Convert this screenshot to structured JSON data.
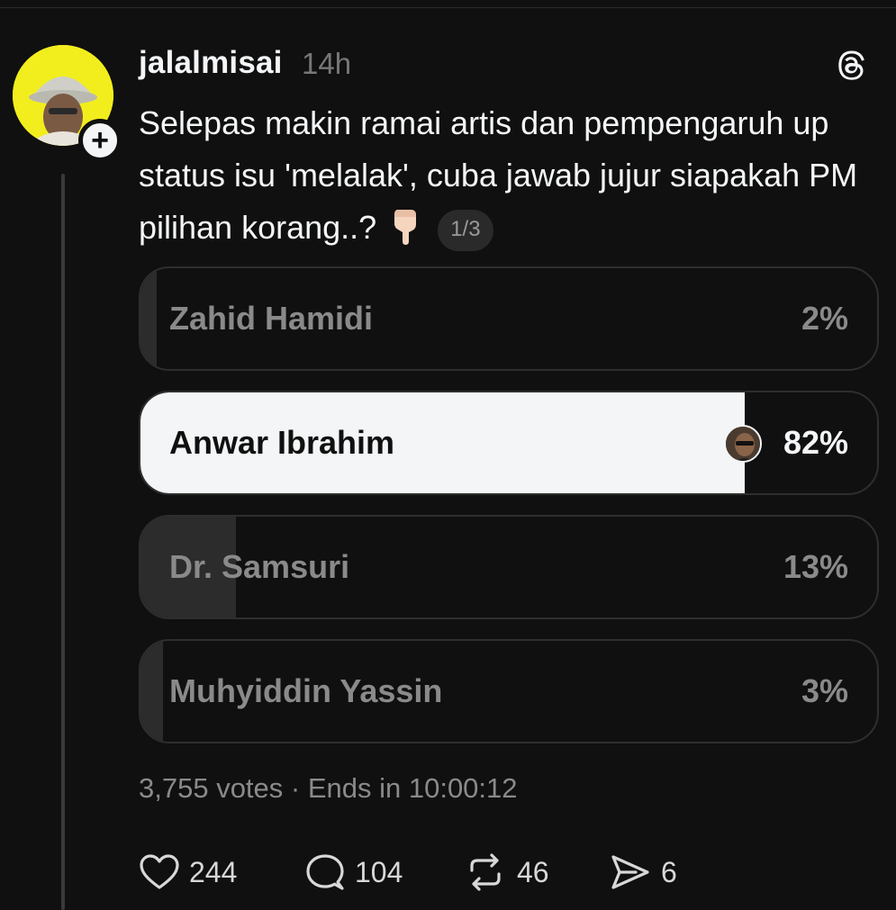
{
  "post": {
    "username": "jalalmisai",
    "timestamp": "14h",
    "text": "Selepas makin ramai artis dan pempengaruh up status isu 'melalak', cuba jawab jujur siapakah PM pilihan korang..?",
    "page_indicator": "1/3"
  },
  "poll": {
    "options": [
      {
        "label": "Zahid Hamidi",
        "percent_label": "2%",
        "share": 0.02,
        "selected": false
      },
      {
        "label": "Anwar Ibrahim",
        "percent_label": "82%",
        "share": 0.82,
        "selected": true
      },
      {
        "label": "Dr. Samsuri",
        "percent_label": "13%",
        "share": 0.13,
        "selected": false
      },
      {
        "label": "Muhyiddin Yassin",
        "percent_label": "3%",
        "share": 0.03,
        "selected": false
      }
    ],
    "meta": "3,755 votes · Ends in 10:00:12"
  },
  "actions": {
    "likes": "244",
    "replies": "104",
    "reposts": "46",
    "shares": "6"
  },
  "icons": {
    "follow": "plus-icon",
    "logo": "threads-logo-icon",
    "pointer": "backhand-index-pointing-down-icon",
    "like": "heart-icon",
    "reply": "comment-icon",
    "repost": "repost-icon",
    "share": "send-icon"
  },
  "colors": {
    "background": "#101010",
    "text": "#f3f5f7",
    "muted": "#8a8a8a",
    "avatar_bg": "#f2ee1d",
    "selected_fill": "#f3f5f7",
    "unselected_fill": "#2c2c2c"
  }
}
